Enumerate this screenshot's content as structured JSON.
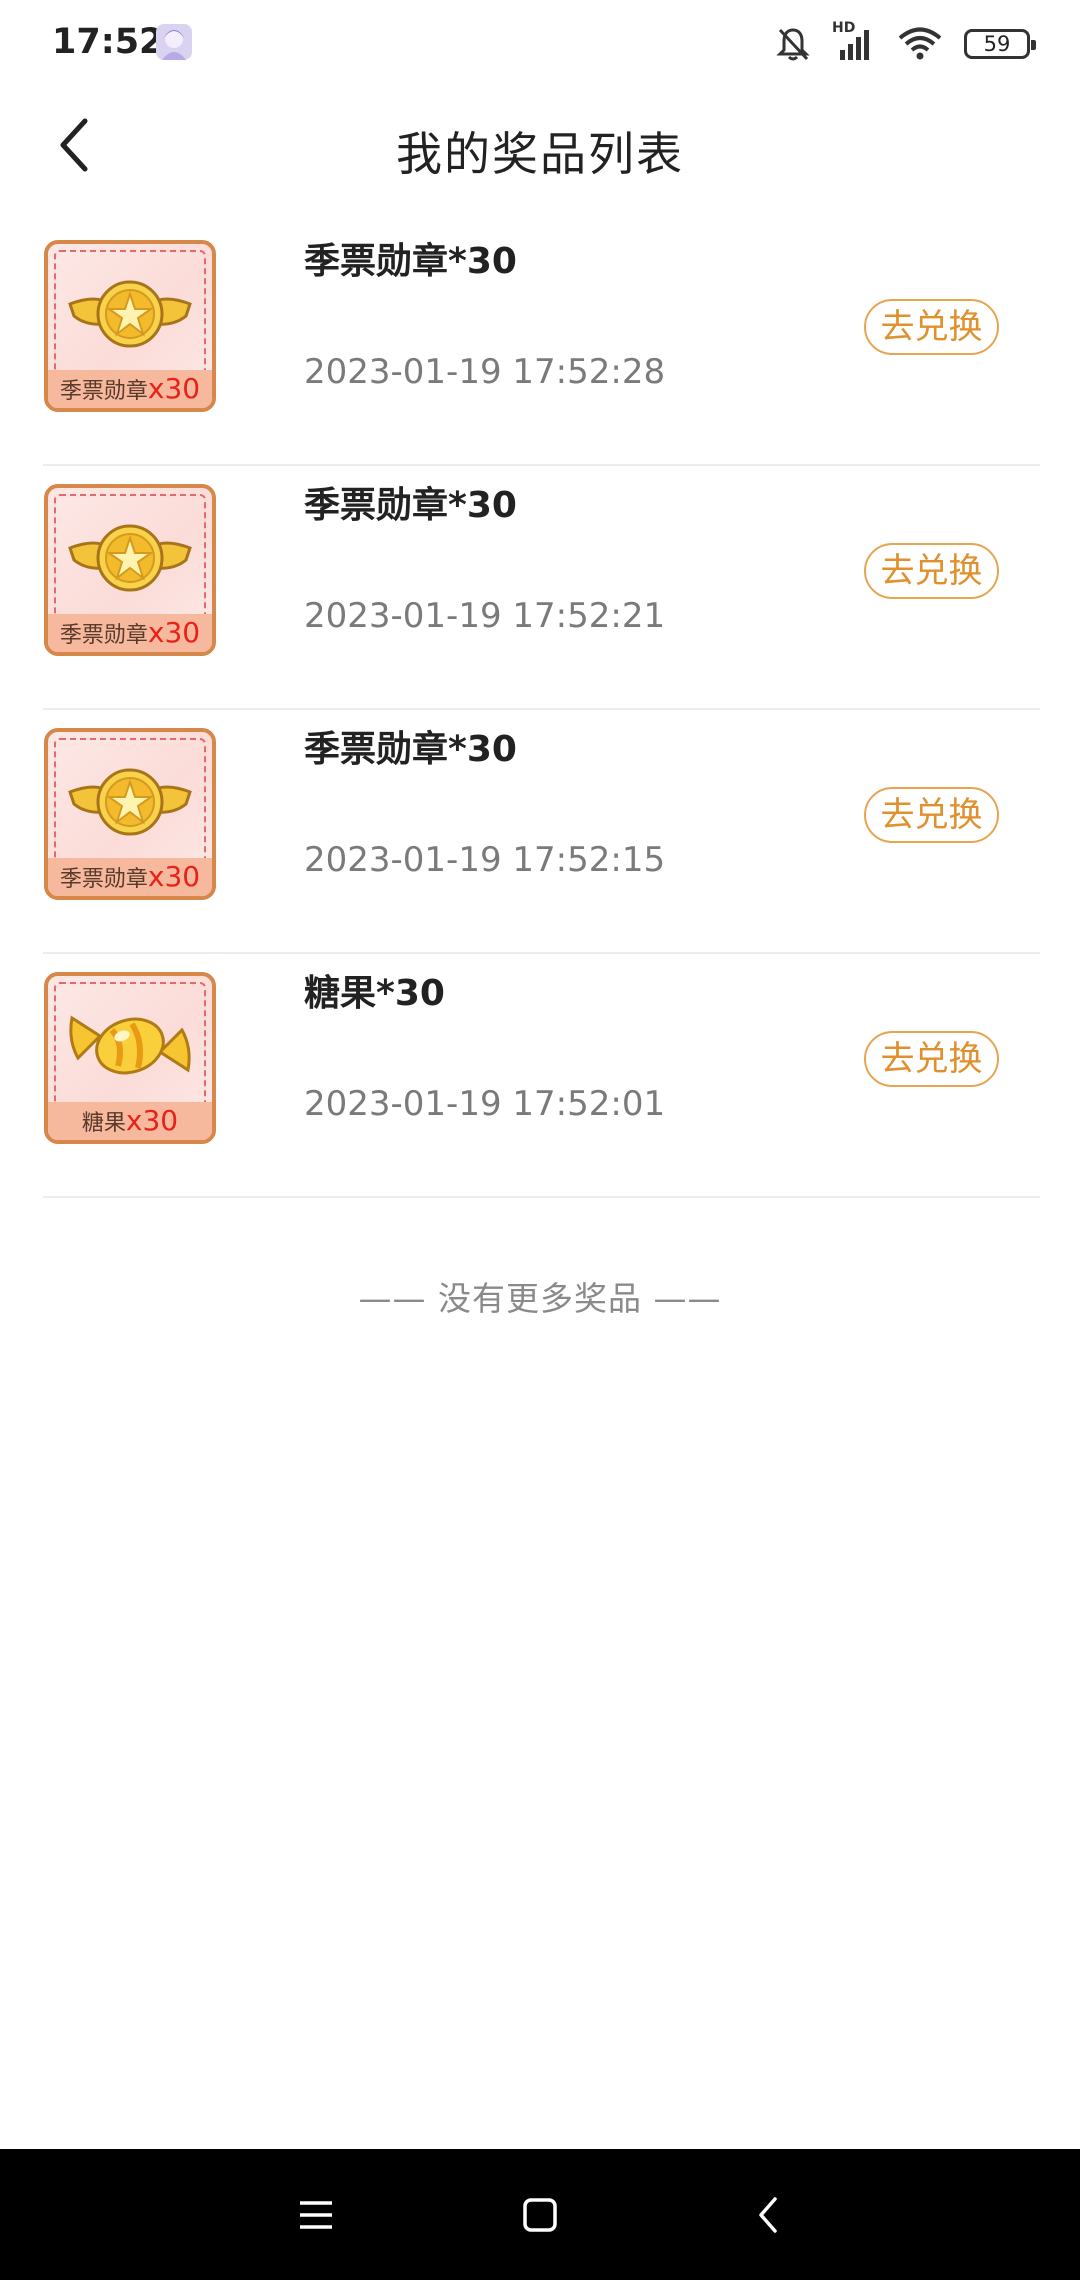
{
  "status_bar": {
    "time": "17:52",
    "network_label": "HD",
    "battery": "59",
    "icons": [
      "avatar-icon",
      "bell-muted-icon",
      "signal-icon",
      "wifi-icon",
      "battery-icon"
    ]
  },
  "header": {
    "title": "我的奖品列表",
    "back_icon": "chevron-left-icon"
  },
  "prizes": [
    {
      "name": "季票勋章*30",
      "time": "2023-01-19 17:52:28",
      "thumb_label": "季票勋章",
      "thumb_qty": "x30",
      "icon": "medal-icon",
      "action": "去兑换"
    },
    {
      "name": "季票勋章*30",
      "time": "2023-01-19 17:52:21",
      "thumb_label": "季票勋章",
      "thumb_qty": "x30",
      "icon": "medal-icon",
      "action": "去兑换"
    },
    {
      "name": "季票勋章*30",
      "time": "2023-01-19 17:52:15",
      "thumb_label": "季票勋章",
      "thumb_qty": "x30",
      "icon": "medal-icon",
      "action": "去兑换"
    },
    {
      "name": "糖果*30",
      "time": "2023-01-19 17:52:01",
      "thumb_label": "糖果",
      "thumb_qty": "x30",
      "icon": "candy-icon",
      "action": "去兑换"
    }
  ],
  "footer_text": "—— 没有更多奖品 ——",
  "nav_bar": {
    "icons": [
      "menu-icon",
      "home-icon",
      "back-icon"
    ]
  },
  "colors": {
    "accent": "#e0902c",
    "thumb_border": "#d6874a",
    "qty_red": "#e8211a"
  }
}
